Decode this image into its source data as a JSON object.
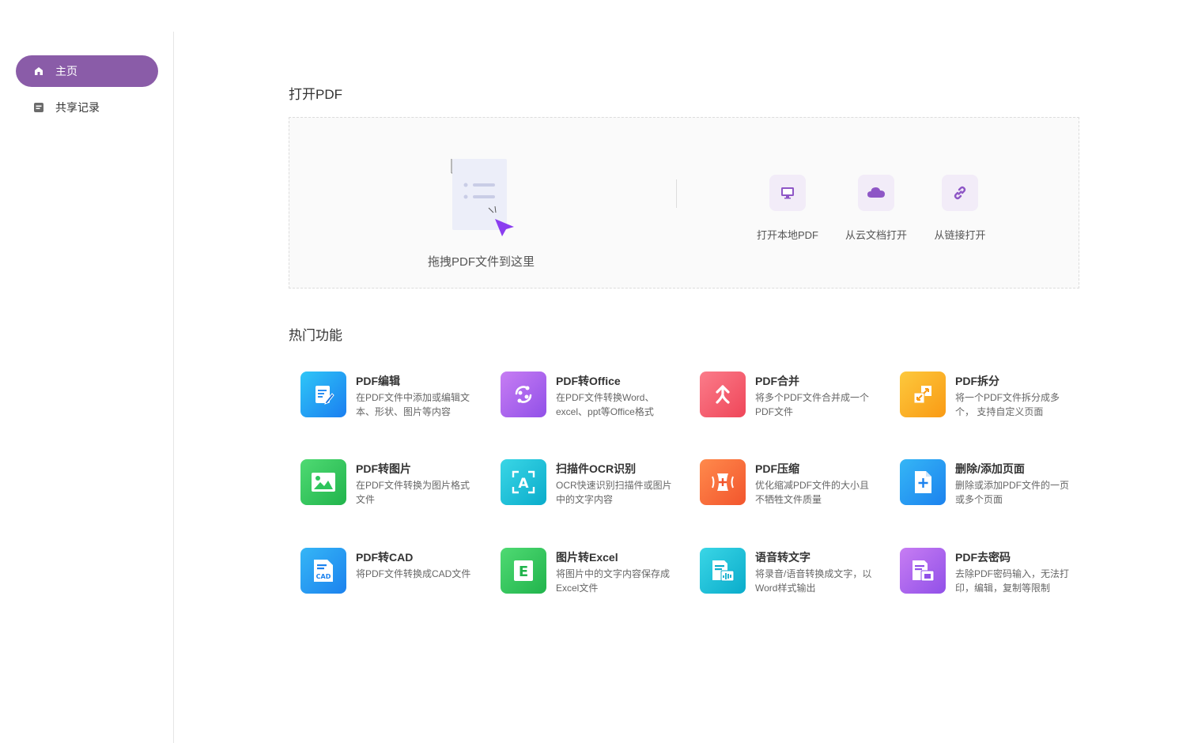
{
  "sidebar": {
    "items": [
      {
        "label": "主页",
        "active": true,
        "icon": "home-icon"
      },
      {
        "label": "共享记录",
        "active": false,
        "icon": "document-icon"
      }
    ]
  },
  "open_pdf": {
    "title": "打开PDF",
    "drop_text": "拖拽PDF文件到这里",
    "options": [
      {
        "label": "打开本地PDF",
        "icon": "monitor-icon"
      },
      {
        "label": "从云文档打开",
        "icon": "cloud-icon"
      },
      {
        "label": "从链接打开",
        "icon": "link-icon"
      }
    ]
  },
  "hot": {
    "title": "热门功能",
    "features": [
      {
        "title": "PDF编辑",
        "desc": "在PDF文件中添加或编辑文本、形状、图片等内容",
        "icon": "edit-document-icon",
        "color": "#1e9bf0"
      },
      {
        "title": "PDF转Office",
        "desc": "在PDF文件转换Word、excel、ppt等Office格式",
        "icon": "convert-icon",
        "color": "#a35fe6"
      },
      {
        "title": "PDF合并",
        "desc": "将多个PDF文件合并成一个PDF文件",
        "icon": "merge-icon",
        "color": "#f25a6a"
      },
      {
        "title": "PDF拆分",
        "desc": "将一个PDF文件拆分成多个， 支持自定义页面",
        "icon": "split-icon",
        "color": "#fbae24"
      },
      {
        "title": "PDF转图片",
        "desc": "在PDF文件转换为图片格式文件",
        "icon": "image-icon",
        "color": "#2ec55c"
      },
      {
        "title": "扫描件OCR识别",
        "desc": "OCR快速识别扫描件或图片中的文字内容",
        "icon": "ocr-scan-icon",
        "color": "#14c0d6"
      },
      {
        "title": "PDF压缩",
        "desc": "优化缩减PDF文件的大小且不牺牲文件质量",
        "icon": "compress-icon",
        "color": "#f6693c"
      },
      {
        "title": "删除/添加页面",
        "desc": "删除或添加PDF文件的一页或多个页面",
        "icon": "add-page-icon",
        "color": "#1e9bf0"
      },
      {
        "title": "PDF转CAD",
        "desc": "将PDF文件转换成CAD文件",
        "icon": "cad-file-icon",
        "color": "#1e9bf0"
      },
      {
        "title": "图片转Excel",
        "desc": "将图片中的文字内容保存成Excel文件",
        "icon": "excel-icon",
        "color": "#2ec55c"
      },
      {
        "title": "语音转文字",
        "desc": "将录音/语音转换成文字，以Word样式输出",
        "icon": "speech-to-text-icon",
        "color": "#14c0d6"
      },
      {
        "title": "PDF去密码",
        "desc": "去除PDF密码输入，无法打印，编辑，复制等限制",
        "icon": "unlock-icon",
        "color": "#a35fe6"
      }
    ]
  },
  "cad_badge": "CAD",
  "ocr_badge": "A",
  "excel_badge": "E"
}
